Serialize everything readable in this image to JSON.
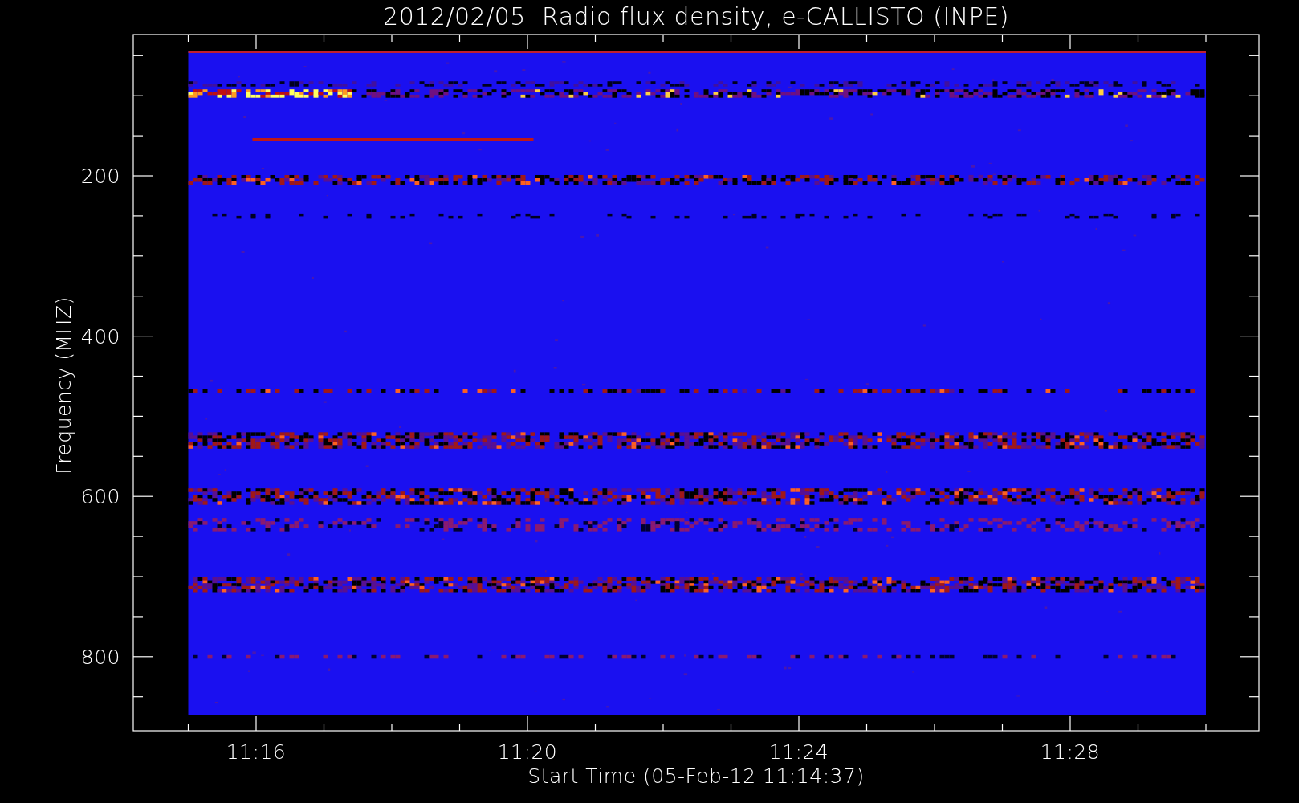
{
  "plot": {
    "title": "2012/02/05  Radio flux density, e-CALLISTO (INPE)",
    "ylabel": "Frequency (MHZ)",
    "xlabel": "Start Time (05-Feb-12 11:14:37)",
    "yticks": [
      "200",
      "400",
      "600",
      "800"
    ],
    "xticks": [
      "11:16",
      "11:20",
      "11:24",
      "11:28"
    ]
  }
}
